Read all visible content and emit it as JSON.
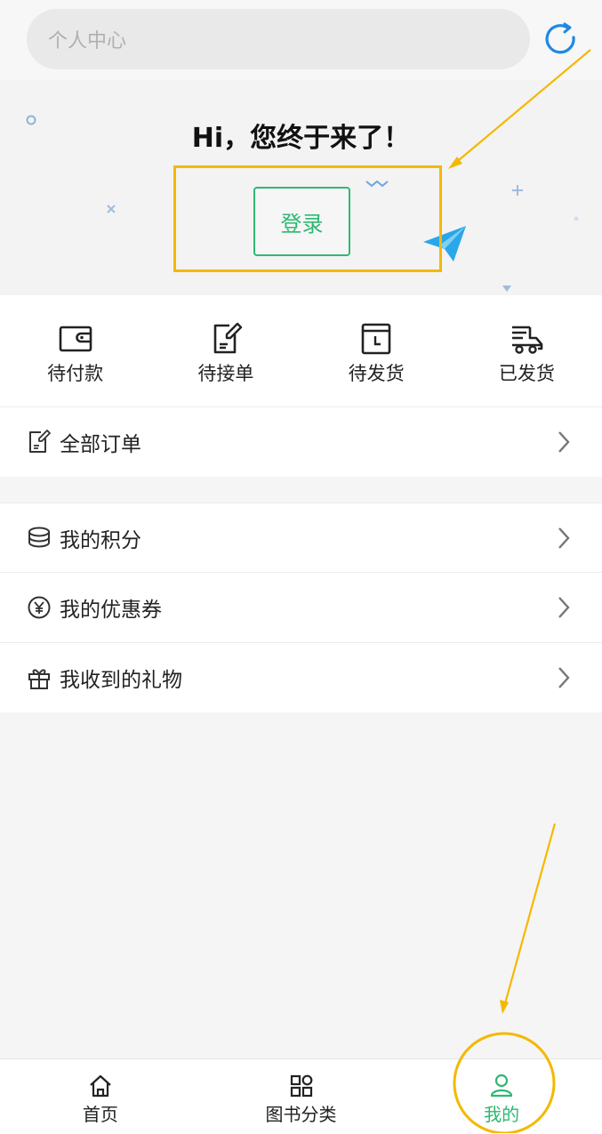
{
  "search": {
    "placeholder": "个人中心"
  },
  "hero": {
    "greeting": "Hi，您终于来了！",
    "login_label": "登录"
  },
  "orders": [
    {
      "label": "待付款",
      "icon": "wallet-icon"
    },
    {
      "label": "待接单",
      "icon": "note-edit-icon"
    },
    {
      "label": "待发货",
      "icon": "clock-calendar-icon"
    },
    {
      "label": "已发货",
      "icon": "truck-icon"
    }
  ],
  "menu": {
    "all_orders": "全部订单",
    "points": "我的积分",
    "coupons": "我的优惠券",
    "gifts": "我收到的礼物"
  },
  "tabbar": [
    {
      "label": "首页",
      "icon": "home-icon"
    },
    {
      "label": "图书分类",
      "icon": "grid-icon"
    },
    {
      "label": "我的",
      "icon": "user-icon",
      "active": true
    }
  ],
  "colors": {
    "accent": "#2eb872",
    "annotation": "#f5b800",
    "blue": "#1e88e5"
  }
}
